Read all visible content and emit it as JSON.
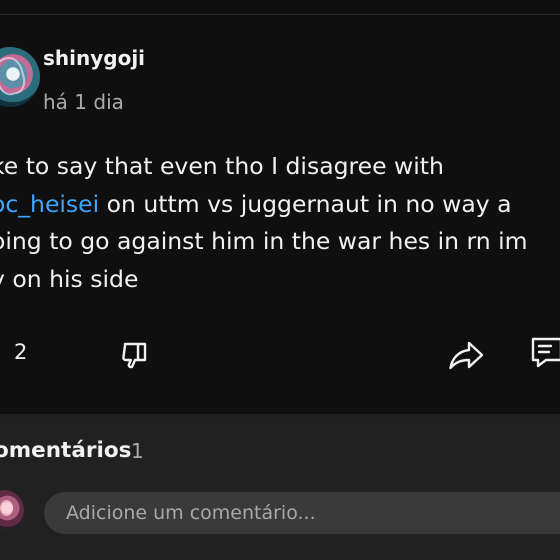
{
  "comment": {
    "author": "shinygoji",
    "timestamp": "há 1 dia",
    "text": {
      "line1": "ke to say that even tho I disagree with",
      "line2_mention": "oc_heisei",
      "line2_rest": "  on uttm vs juggernaut in no way a",
      "line3": "oing to go against him in the war hes in rn im",
      "line4": "y on his side"
    },
    "mention_color": "#3ea6ff",
    "likes": "2"
  },
  "actions": {
    "dislike_icon": "thumbs-down-icon",
    "share_icon": "share-icon",
    "reply_icon": "comment-icon"
  },
  "comments_section": {
    "title": "omentários",
    "count": "1",
    "placeholder": "Adicione um comentário..."
  }
}
